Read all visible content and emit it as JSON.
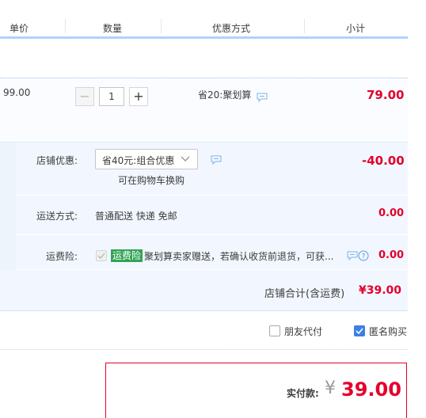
{
  "header": {
    "col_price": "单价",
    "col_qty": "数量",
    "col_discount": "优惠方式",
    "col_subtotal": "小计"
  },
  "item": {
    "unit_price": "99.00",
    "quantity": "1",
    "minus_symbol": "−",
    "plus_symbol": "+",
    "discount_text": "省20:聚划算",
    "subtotal": "79.00"
  },
  "shop": {
    "promo_label": "店铺优惠:",
    "promo_selected": "省40元:组合优惠",
    "promo_hint": "可在购物车换购",
    "promo_amount": "-40.00",
    "shipping_label": "运送方式:",
    "shipping_value": "普通配送 快递 免邮",
    "shipping_amount": "0.00",
    "insurance_label": "运费险:",
    "insurance_badge": "运费险",
    "insurance_text": "聚划算卖家赠送，若确认收货前退货，可获...",
    "insurance_amount": "0.00",
    "shop_total_label": "店铺合计(含运费)",
    "shop_total_value": "¥39.00"
  },
  "options": {
    "friend_pay_label": "朋友代付",
    "friend_pay_checked": false,
    "anonymous_label": "匿名购买",
    "anonymous_checked": true
  },
  "payment": {
    "label": "实付款:",
    "currency": "¥",
    "amount": "39.00"
  },
  "colors": {
    "accent_red": "#e4002b",
    "header_border": "#b2d1ff",
    "shop_bg": "#f2f7ff",
    "badge_green": "#31a354",
    "checkbox_blue": "#3d7fe6"
  }
}
